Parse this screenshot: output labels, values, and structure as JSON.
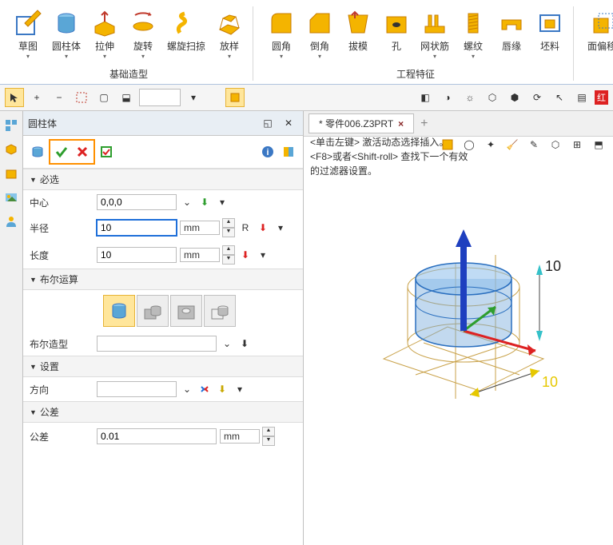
{
  "ribbon": {
    "group1_label": "基础造型",
    "group2_label": "工程特征",
    "btns1": [
      {
        "label": "草图"
      },
      {
        "label": "圆柱体"
      },
      {
        "label": "拉伸"
      },
      {
        "label": "旋转"
      },
      {
        "label": "螺旋扫掠"
      },
      {
        "label": "放样"
      }
    ],
    "btns2": [
      {
        "label": "圆角"
      },
      {
        "label": "倒角"
      },
      {
        "label": "拔模"
      },
      {
        "label": "孔"
      },
      {
        "label": "网状筋"
      },
      {
        "label": "螺纹"
      },
      {
        "label": "唇缘"
      },
      {
        "label": "坯料"
      }
    ],
    "btns3": [
      {
        "label": "面偏移"
      }
    ],
    "red_badge": "红"
  },
  "panel": {
    "title": "圆柱体",
    "sections": {
      "required": "必选",
      "boolean": "布尔运算",
      "settings": "设置",
      "tolerance": "公差"
    },
    "fields": {
      "center": {
        "label": "中心",
        "value": "0,0,0"
      },
      "radius": {
        "label": "半径",
        "value": "10",
        "unit": "mm",
        "R": "R"
      },
      "length": {
        "label": "长度",
        "value": "10",
        "unit": "mm"
      },
      "bool_shape": {
        "label": "布尔造型",
        "value": ""
      },
      "direction": {
        "label": "方向",
        "value": ""
      },
      "tolerance": {
        "label": "公差",
        "value": "0.01",
        "unit": "mm"
      }
    }
  },
  "viewport": {
    "tab": "* 零件006.Z3PRT",
    "hint_line1": "<单击左键> 激活动态选择插入。",
    "hint_line2": "<F8>或者<Shift-roll> 查找下一个有效的过滤器设置。",
    "dim1": "10",
    "dim2": "10"
  }
}
